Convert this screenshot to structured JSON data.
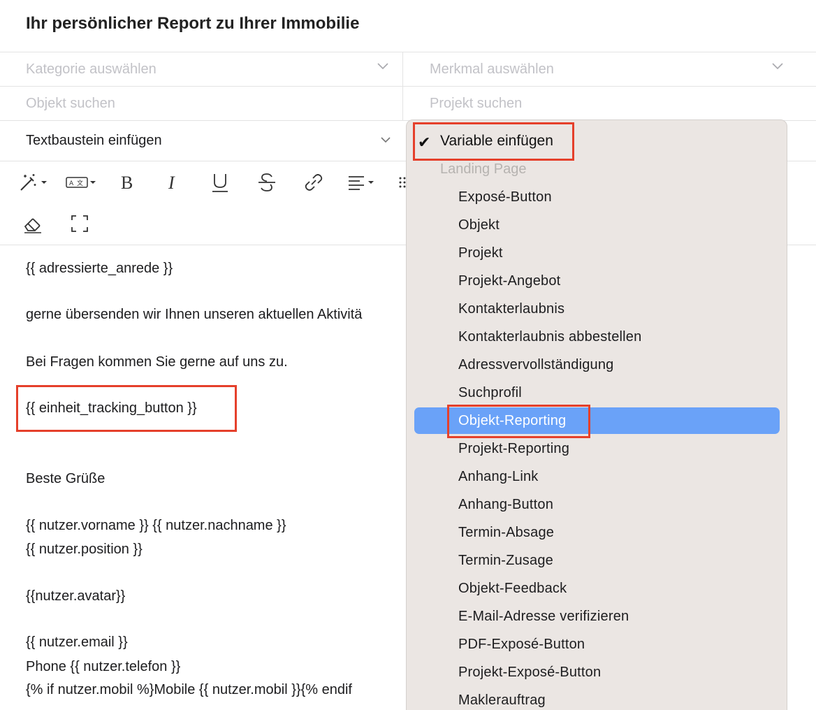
{
  "title": "Ihr persönlicher Report zu Ihrer Immobilie",
  "filters": {
    "kategorie_placeholder": "Kategorie auswählen",
    "merkmal_placeholder": "Merkmal auswählen",
    "objekt_placeholder": "Objekt suchen",
    "projekt_placeholder": "Projekt suchen",
    "textbaustein_label": "Textbaustein einfügen"
  },
  "editor": {
    "lines": [
      "{{ adressierte_anrede }}",
      "gerne übersenden wir Ihnen unseren aktuellen Aktivitä",
      "Bei Fragen kommen Sie gerne auf uns zu.",
      "{{ einheit_tracking_button }}",
      "Beste Grüße",
      "{{ nutzer.vorname }} {{ nutzer.nachname }}",
      "{{ nutzer.position }}",
      "{{nutzer.avatar}}",
      "{{ nutzer.email }}",
      "Phone {{ nutzer.telefon }}",
      "{% if nutzer.mobil %}Mobile {{ nutzer.mobil }}{% endif"
    ]
  },
  "dropdown": {
    "selected_label": "Variable einfügen",
    "checkmark": "✔",
    "group_header": "Landing Page",
    "items": [
      "Exposé-Button",
      "Objekt",
      "Projekt",
      "Projekt-Angebot",
      "Kontakterlaubnis",
      "Kontakterlaubnis abbestellen",
      "Adressvervollständigung",
      "Suchprofil",
      "Objekt-Reporting",
      "Projekt-Reporting",
      "Anhang-Link",
      "Anhang-Button",
      "Termin-Absage",
      "Termin-Zusage",
      "Objekt-Feedback",
      "E-Mail-Adresse verifizieren",
      "PDF-Exposé-Button",
      "Projekt-Exposé-Button",
      "Maklerauftrag"
    ],
    "highlighted_item": "Objekt-Reporting"
  },
  "colors": {
    "highlight": "#6aa2f8",
    "annotation_box": "#e5402b",
    "dropdown_bg": "#ebe6e3"
  }
}
